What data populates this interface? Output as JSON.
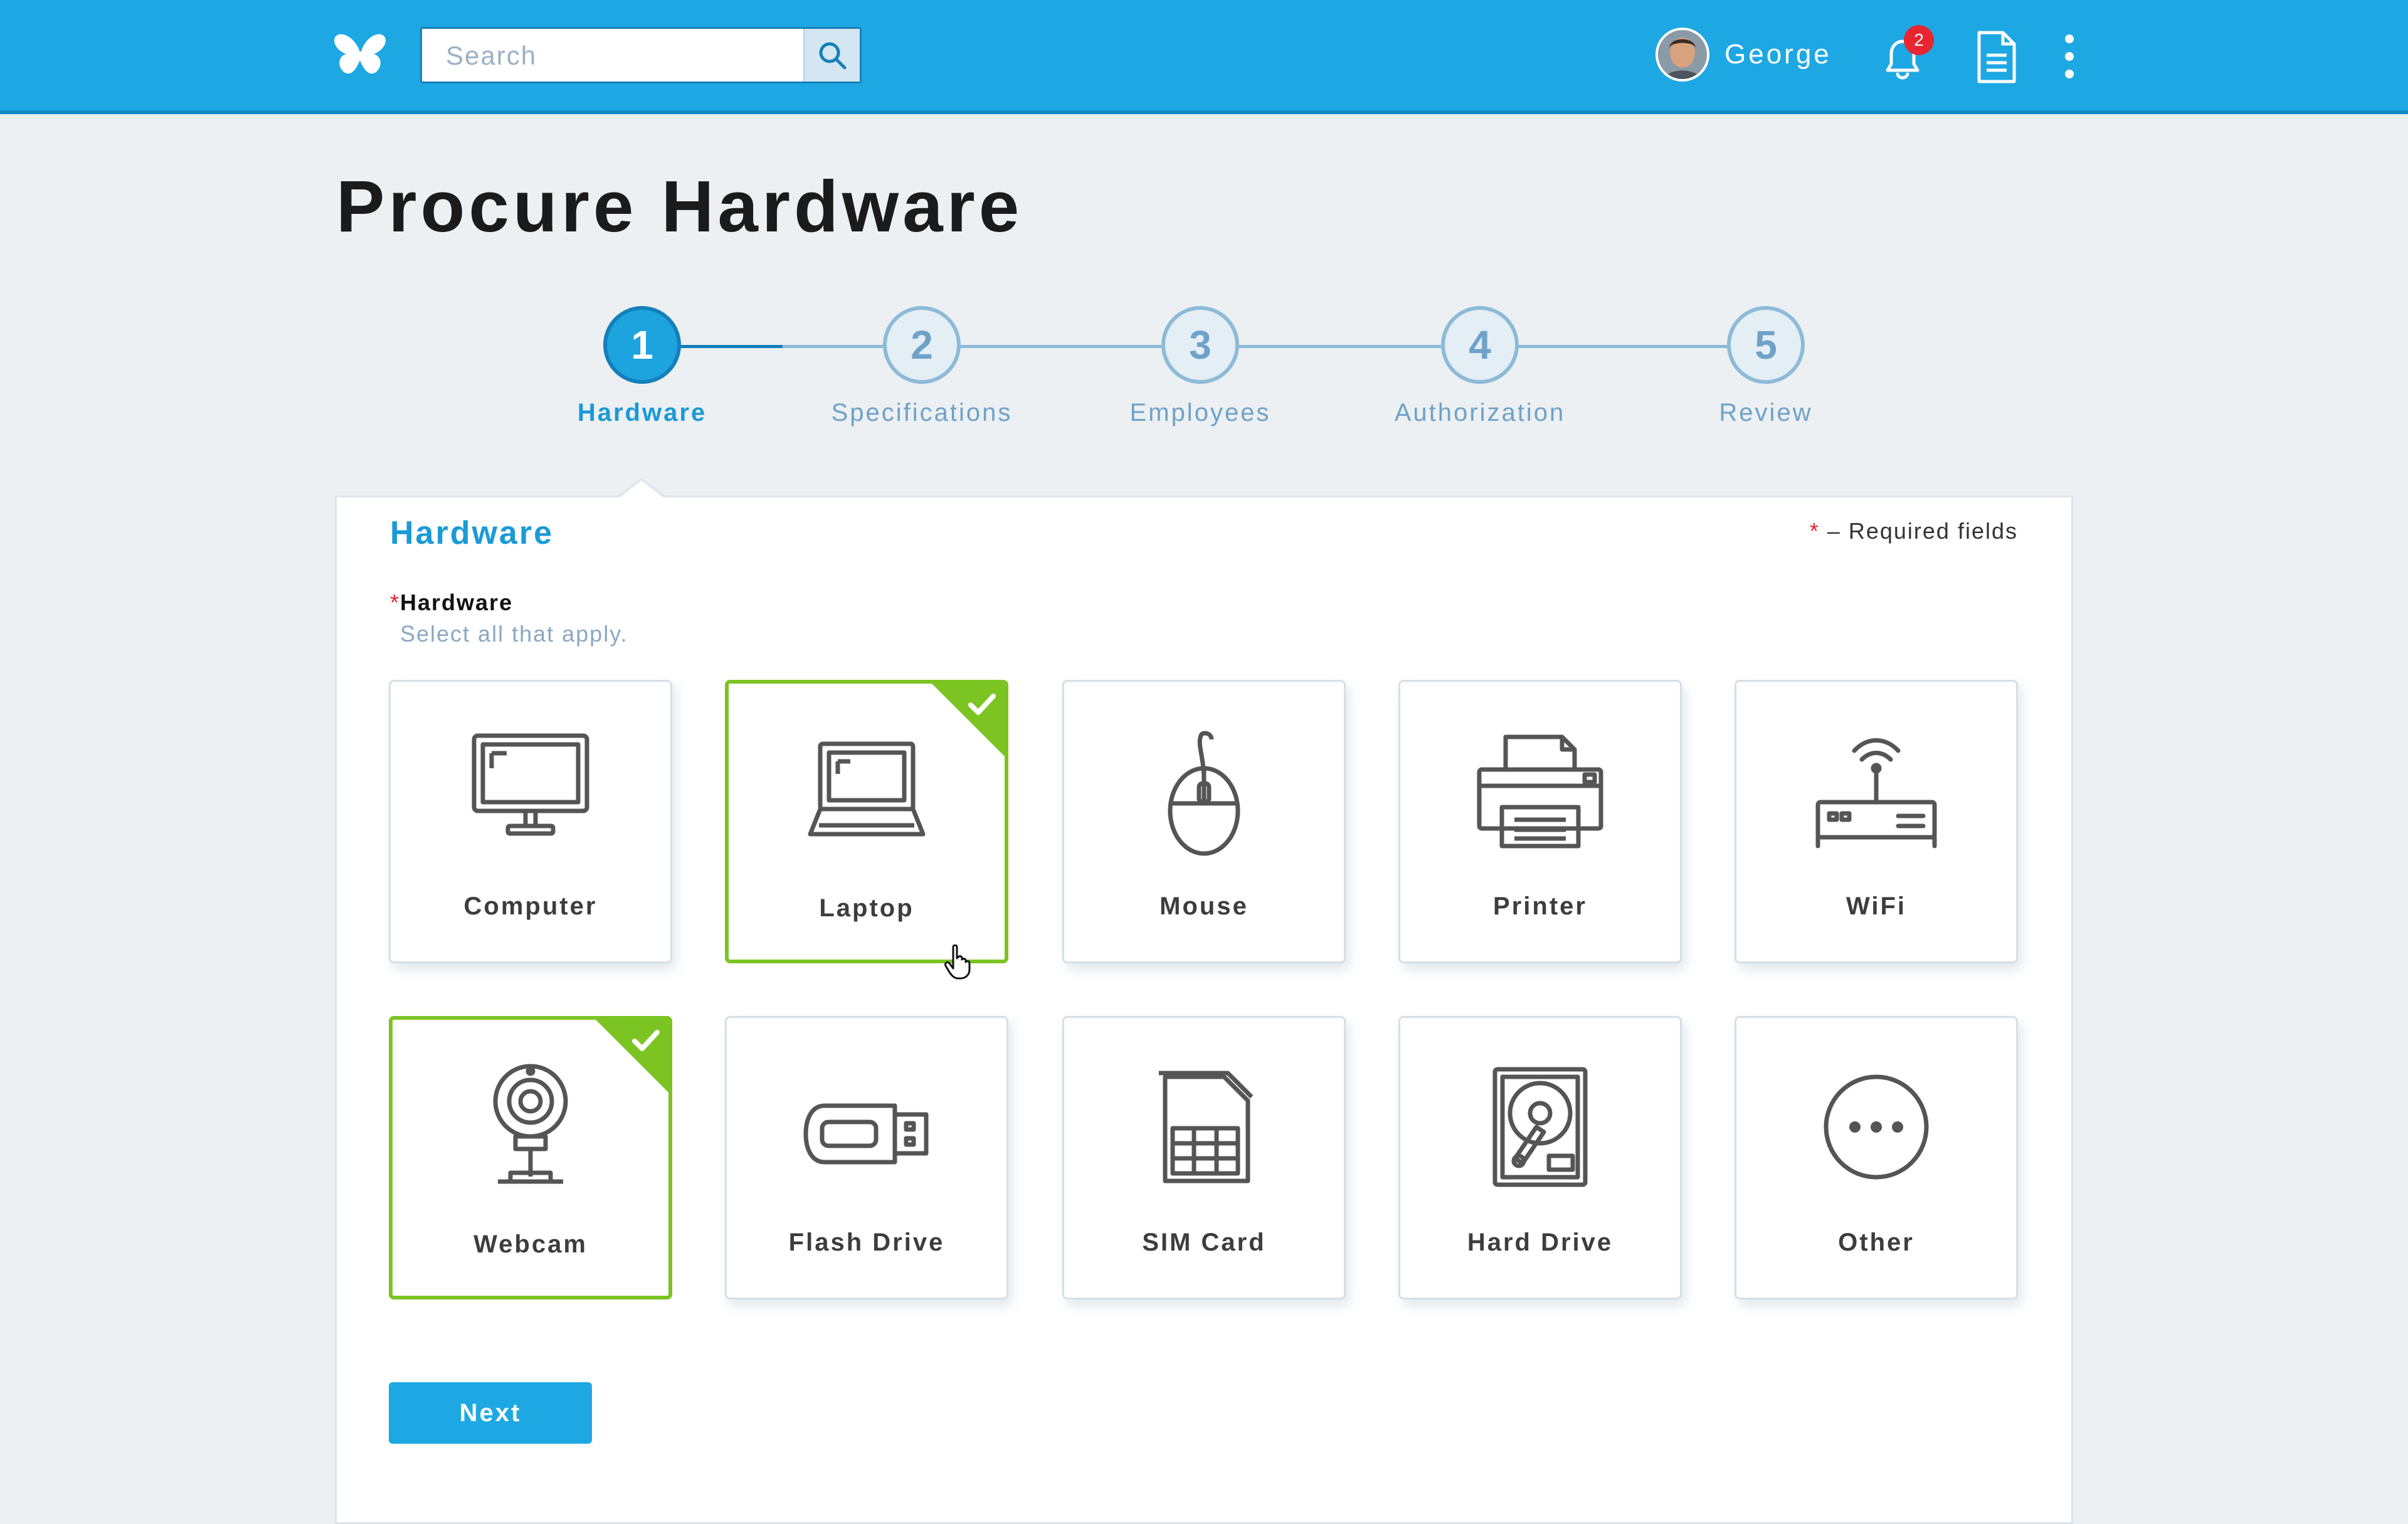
{
  "header": {
    "search_placeholder": "Search",
    "user_name": "George",
    "notification_count": "2"
  },
  "page": {
    "title": "Procure Hardware"
  },
  "stepper": {
    "current_step": 1,
    "steps": [
      {
        "number": "1",
        "label": "Hardware"
      },
      {
        "number": "2",
        "label": "Specifications"
      },
      {
        "number": "3",
        "label": "Employees"
      },
      {
        "number": "4",
        "label": "Authorization"
      },
      {
        "number": "5",
        "label": "Review"
      }
    ]
  },
  "form": {
    "section_title": "Hardware",
    "required_star": "*",
    "required_note": "– Required fields",
    "field_label": "Hardware",
    "field_hint": "Select all that apply.",
    "options": [
      {
        "label": "Computer",
        "icon": "computer-icon",
        "selected": false
      },
      {
        "label": "Laptop",
        "icon": "laptop-icon",
        "selected": true
      },
      {
        "label": "Mouse",
        "icon": "mouse-icon",
        "selected": false
      },
      {
        "label": "Printer",
        "icon": "printer-icon",
        "selected": false
      },
      {
        "label": "WiFi",
        "icon": "wifi-router-icon",
        "selected": false
      },
      {
        "label": "Webcam",
        "icon": "webcam-icon",
        "selected": true
      },
      {
        "label": "Flash Drive",
        "icon": "flash-drive-icon",
        "selected": false
      },
      {
        "label": "SIM Card",
        "icon": "sim-card-icon",
        "selected": false
      },
      {
        "label": "Hard Drive",
        "icon": "hard-drive-icon",
        "selected": false
      },
      {
        "label": "Other",
        "icon": "more-icon",
        "selected": false
      }
    ],
    "next_label": "Next"
  },
  "colors": {
    "header_blue": "#1da8e4",
    "accent_blue": "#1a9ad6",
    "selected_green": "#7cc422",
    "required_red": "#e8262f",
    "step_inactive": "#8cbbd8"
  }
}
